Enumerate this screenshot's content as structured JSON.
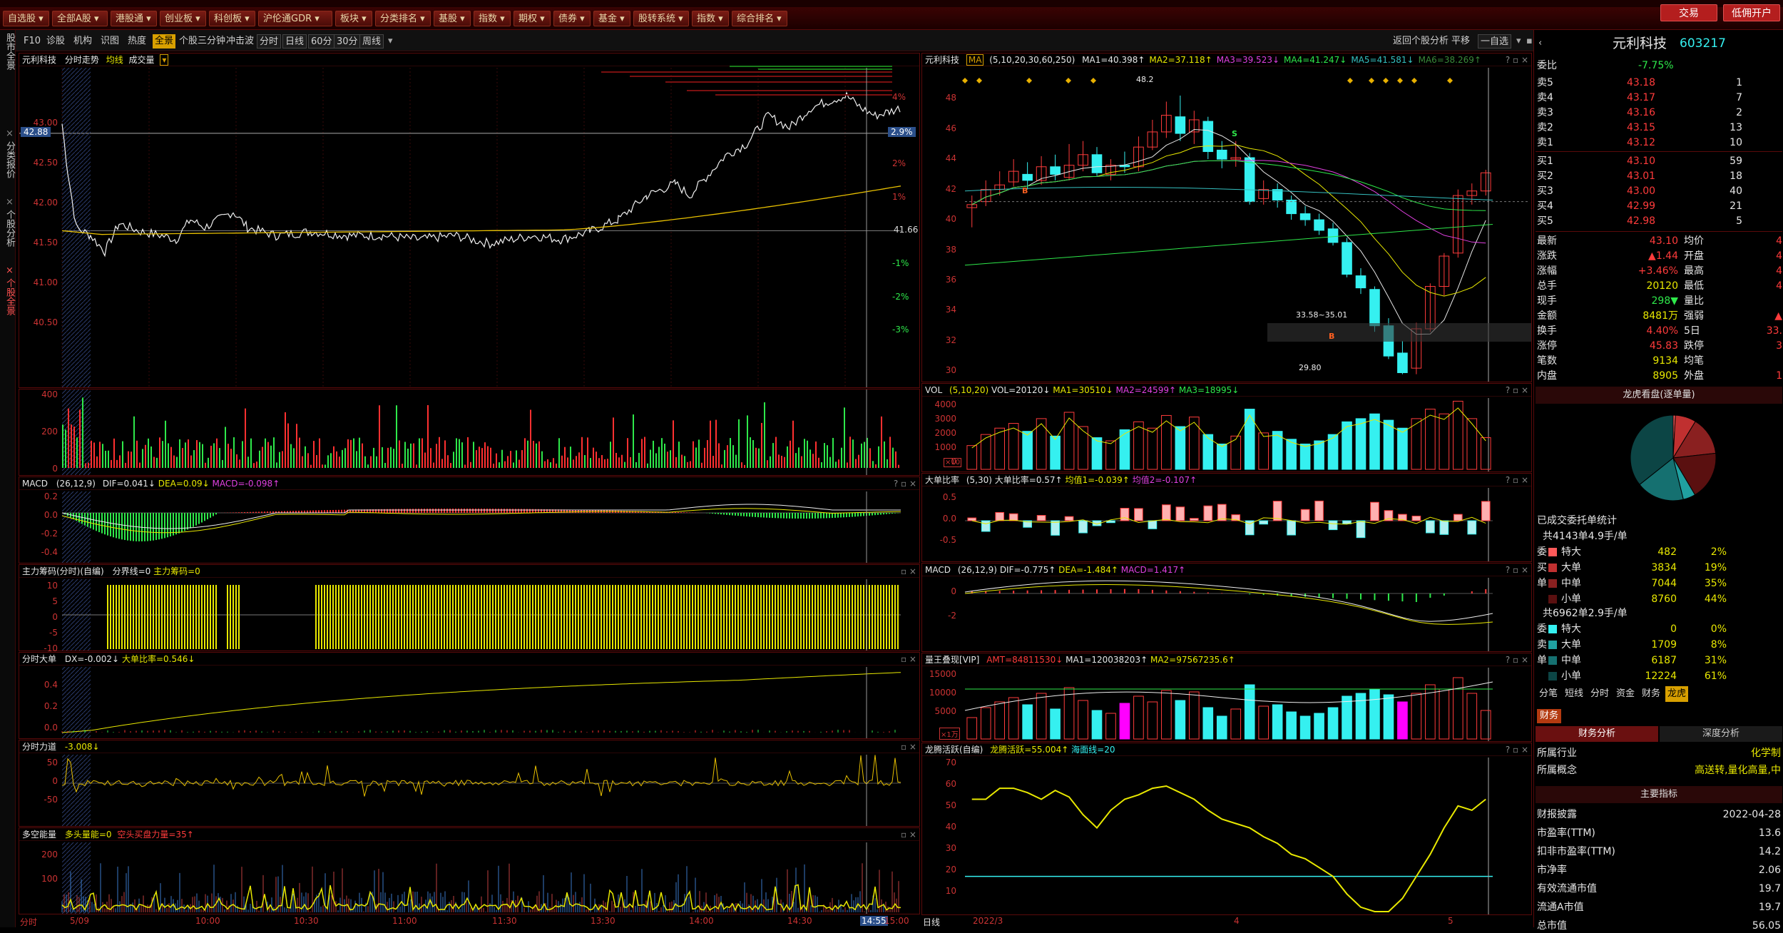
{
  "menu": [
    "自选股",
    "全部A股",
    "港股通",
    "创业板",
    "科创板",
    "沪伦通GDR",
    "板块",
    "分类排名",
    "基股",
    "指数",
    "期权",
    "债券",
    "基金",
    "股转系统",
    "指数",
    "综合排名"
  ],
  "menu_right": {
    "trade": "交易",
    "open_account": "低佣开户"
  },
  "side_tabs": [
    "股市全景",
    "分类报价",
    "个股分析",
    "个股全景"
  ],
  "toolbar": {
    "left": [
      "F10",
      "诊股",
      "机构",
      "识图",
      "热度",
      "全景",
      "个股三分钟",
      "冲击波"
    ],
    "periods": [
      "分时",
      "日线",
      "60分",
      "30分",
      "周线"
    ],
    "right": [
      "返回个股分析",
      "平移",
      "一自选"
    ]
  },
  "intraday": {
    "name": "元利科技",
    "title": "分时走势",
    "avg_label": "均线",
    "vol_label": "成交量",
    "y_labels": [
      "43.00",
      "42.50",
      "42.00",
      "41.50",
      "41.00",
      "40.50"
    ],
    "current_price_tag": "42.88",
    "pct_tag": "2.9%",
    "base_price_label": "41.66",
    "pct_labels": [
      "4%",
      "3%",
      "2%",
      "1%",
      "-1%",
      "-2%",
      "-3%"
    ],
    "vol_labels": [
      "400",
      "200",
      "0"
    ],
    "macd": {
      "title": "MACD",
      "params": "(26,12,9)",
      "dif": "DIF=0.041↓",
      "dea": "DEA=0.09↓",
      "macd": "MACD=-0.098↑",
      "labels": [
        "0.2",
        "0.0",
        "-0.2",
        "-0.4"
      ]
    },
    "chip": {
      "title": "主力筹码(分时)(自编)",
      "line": "分界线=0",
      "value": "主力筹码=0",
      "labels": [
        "10",
        "5",
        "0",
        "-5",
        "-10"
      ]
    },
    "dadan": {
      "title": "分时大单",
      "dx": "DX=-0.002↓",
      "ratio": "大单比率=0.546↓",
      "labels": [
        "0.4",
        "0.2",
        "0.0"
      ]
    },
    "force": {
      "title": "分时力道",
      "value": "-3.008↓",
      "labels": [
        "50",
        "0",
        "-50"
      ]
    },
    "energy": {
      "title": "多空能量",
      "a": "多头量能=0",
      "b": "空头买盘力量=35↑",
      "labels": [
        "200",
        "100"
      ]
    },
    "time_labels": [
      "分时",
      "5/09",
      "10:00",
      "10:30",
      "11:00",
      "11:30",
      "13:30",
      "14:00",
      "14:30",
      "14:55",
      "15:00"
    ]
  },
  "daily": {
    "name": "元利科技",
    "ma": "MA",
    "ma_params": "(5,10,20,30,60,250)",
    "ma_values": [
      {
        "label": "MA1=40.398↑",
        "color": "#e6e6e6"
      },
      {
        "label": "MA2=37.118↑",
        "color": "#e8e800"
      },
      {
        "label": "MA3=39.523↓",
        "color": "#e040e0"
      },
      {
        "label": "MA4=41.247↓",
        "color": "#2ee84a"
      },
      {
        "label": "MA5=41.581↓",
        "color": "#35c0c0"
      },
      {
        "label": "MA6=38.269↑",
        "color": "#3a8a3a"
      }
    ],
    "y_labels": [
      "48",
      "46",
      "44",
      "42",
      "40",
      "38",
      "36",
      "34",
      "32",
      "30"
    ],
    "annotations": {
      "high": "48.2",
      "low": "29.80",
      "mid": "33.58~35.01",
      "buy": "B",
      "sell": "S"
    },
    "vol": {
      "title": "VOL",
      "params": "(5,10,20)",
      "vol": "VOL=20120↓",
      "ma1": "MA1=30510↓",
      "ma2": "MA2=24599↑",
      "ma3": "MA3=18995↓",
      "labels": [
        "4000",
        "3000",
        "2000",
        "1000",
        "0"
      ],
      "unit": "×10"
    },
    "ddbl": {
      "title": "大单比率",
      "params": "(5,30)",
      "v": "大单比率=0.57↑",
      "j1": "均值1=-0.039↑",
      "j2": "均值2=-0.107↑",
      "labels": [
        "0.5",
        "0.0",
        "-0.5"
      ]
    },
    "macd": {
      "title": "MACD",
      "params": "(26,12,9)",
      "dif": "DIF=-0.775↑",
      "dea": "DEA=-1.484↑",
      "macd": "MACD=1.417↑",
      "labels": [
        "0",
        "-2"
      ]
    },
    "ljzx": {
      "title": "量王叠现[VIP]",
      "amt": "AMT=84811530↓",
      "ma1": "MA1=120038203↑",
      "ma2": "MA2=97567235.6↑",
      "labels": [
        "15000",
        "10000",
        "5000"
      ],
      "unit": "×1万"
    },
    "lthy": {
      "title": "龙腾活跃(自编)",
      "v": "龙腾活跃=55.004↑",
      "h": "海面线=20",
      "labels": [
        "70",
        "60",
        "50",
        "40",
        "30",
        "20",
        "10"
      ]
    },
    "date_labels": [
      "日线",
      "2022/3",
      "4",
      "5"
    ]
  },
  "quote": {
    "name": "元利科技",
    "code": "603217",
    "weibi_label": "委比",
    "weibi": "-7.75%",
    "asks": [
      [
        "卖5",
        "43.18",
        "1"
      ],
      [
        "卖4",
        "43.17",
        "7"
      ],
      [
        "卖3",
        "43.16",
        "2"
      ],
      [
        "卖2",
        "43.15",
        "13"
      ],
      [
        "卖1",
        "43.12",
        "10"
      ]
    ],
    "bids": [
      [
        "买1",
        "43.10",
        "59"
      ],
      [
        "买2",
        "43.01",
        "18"
      ],
      [
        "买3",
        "43.00",
        "40"
      ],
      [
        "买4",
        "42.99",
        "21"
      ],
      [
        "买5",
        "42.98",
        "5"
      ]
    ],
    "stats": [
      [
        "最新",
        "43.10",
        "均价",
        "4"
      ],
      [
        "涨跌",
        "▲1.44",
        "开盘",
        "4"
      ],
      [
        "涨幅",
        "+3.46%",
        "最高",
        "4"
      ],
      [
        "总手",
        "20120",
        "最低",
        "4"
      ],
      [
        "现手",
        "298▼",
        "量比",
        ""
      ],
      [
        "金额",
        "8481万",
        "强弱",
        "▲"
      ],
      [
        "换手",
        "4.40%",
        "5日",
        "33."
      ],
      [
        "涨停",
        "45.83",
        "跌停",
        "3"
      ],
      [
        "笔数",
        "9134",
        "均笔",
        ""
      ],
      [
        "内盘",
        "8905",
        "外盘",
        "1"
      ]
    ],
    "dragon_title": "龙虎看盘(逐单量)",
    "traded_title": "已成交委托单统计",
    "buy_summary": "共4143单4.9手/单",
    "buy_rows": [
      [
        "特大",
        "482",
        "2%",
        "#ff5a5a"
      ],
      [
        "大单",
        "3834",
        "19%",
        "#c03030"
      ],
      [
        "中单",
        "7044",
        "35%",
        "#8a2020"
      ],
      [
        "小单",
        "8760",
        "44%",
        "#5a1010"
      ]
    ],
    "buy_side": [
      "委",
      "买",
      "单"
    ],
    "sell_summary": "共6962单2.9手/单",
    "sell_rows": [
      [
        "特大",
        "0",
        "0%",
        "#35f0f0"
      ],
      [
        "大单",
        "1709",
        "8%",
        "#20a0a0"
      ],
      [
        "中单",
        "6187",
        "31%",
        "#157070"
      ],
      [
        "小单",
        "12224",
        "61%",
        "#0c4545"
      ]
    ],
    "sell_side": [
      "委",
      "卖",
      "单"
    ],
    "tabs": [
      "分笔",
      "短线",
      "分时",
      "资金",
      "财务",
      "龙虎"
    ],
    "finance_tab": "财务",
    "fin_tabs": [
      "财务分析",
      "深度分析"
    ],
    "industry": [
      [
        "所属行业",
        "化学制"
      ],
      [
        "所属概念",
        "高送转,量化高量,中"
      ]
    ],
    "indicators_title": "主要指标",
    "indicators": [
      [
        "财报披露",
        "2022-04-28"
      ],
      [
        "市盈率(TTM)",
        "13.6"
      ],
      [
        "扣非市盈率(TTM)",
        "14.2"
      ],
      [
        "市净率",
        "2.06"
      ],
      [
        "有效流通市值",
        "19.7"
      ],
      [
        "流通A市值",
        "19.7"
      ],
      [
        "总市值",
        "56.05"
      ]
    ]
  },
  "colors": {
    "up": "#ff3b3b",
    "down": "#35f0f0",
    "frame": "#5a0a0a",
    "chip": "#e8e800"
  }
}
